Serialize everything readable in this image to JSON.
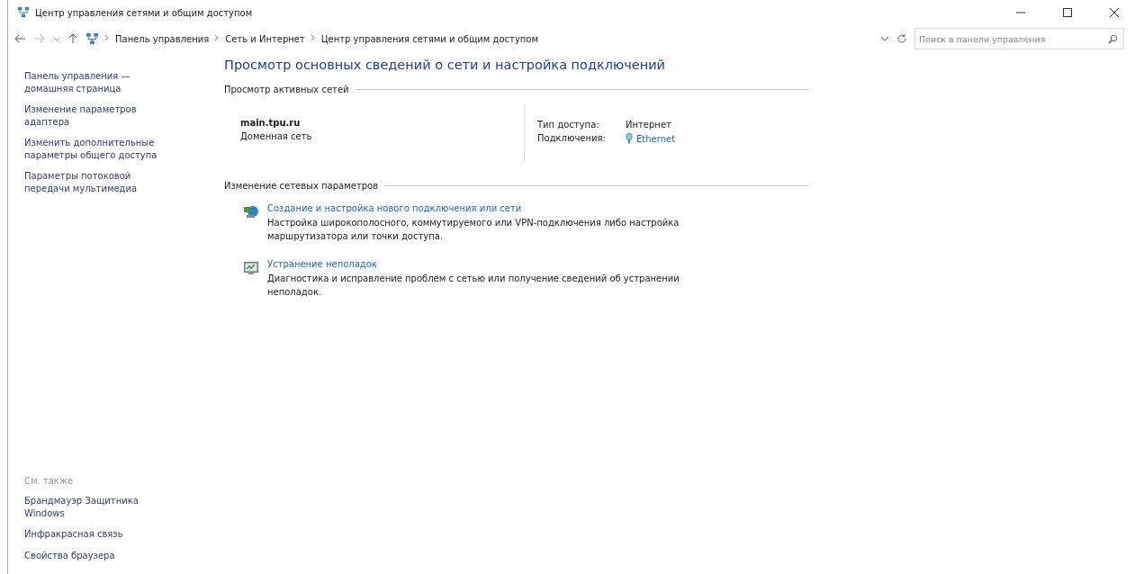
{
  "window": {
    "title": "Центр управления сетями и общим доступом"
  },
  "address_bar": {
    "breadcrumbs": [
      "Панель управления",
      "Сеть и Интернет",
      "Центр управления сетями и общим доступом"
    ],
    "search": {
      "placeholder": "Поиск в панели управления"
    }
  },
  "sidebar": {
    "items": [
      "Панель управления —\nдомашняя страница",
      "Изменение параметров\nадаптера",
      "Изменить дополнительные\nпараметры общего доступа",
      "Параметры потоковой\nпередачи мультимедиа"
    ],
    "see_also": {
      "heading": "См. также",
      "items": [
        "Брандмауэр Защитника\nWindows",
        "Инфракрасная связь",
        "Свойства браузера"
      ]
    }
  },
  "main": {
    "heading": "Просмотр основных сведений о сети и настройка подключений",
    "active_networks": {
      "heading": "Просмотр активных сетей",
      "name": "main.tpu.ru",
      "type": "Доменная сеть",
      "access_label": "Тип доступа:",
      "access_value": "Интернет",
      "connections_label": "Подключения:",
      "connections_value": "Ethernet"
    },
    "change_settings": {
      "heading": "Изменение сетевых параметров",
      "tasks": [
        {
          "kind": "new-connection",
          "link": "Создание и настройка нового подключения или сети",
          "description": "Настройка широкополосного, коммутируемого или VPN-подключения либо настройка\nмаршрутизатора или точки доступа."
        },
        {
          "kind": "troubleshoot",
          "link": "Устранение неполадок",
          "description": "Диагностика и исправление проблем с сетью или получение сведений об устранении\nнеполадок."
        }
      ]
    }
  }
}
